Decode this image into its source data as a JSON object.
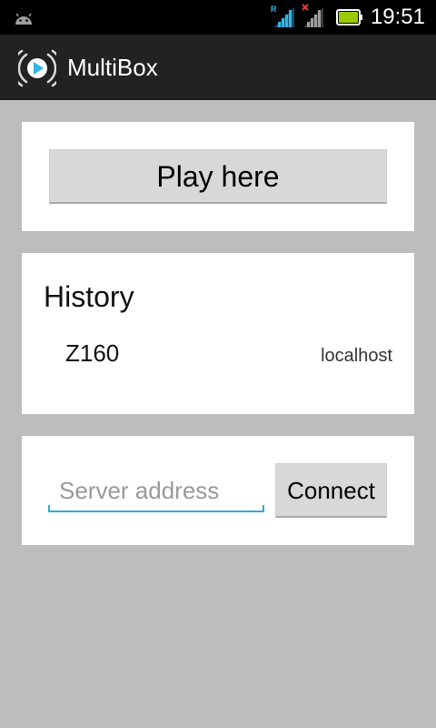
{
  "status_bar": {
    "time": "19:51",
    "roaming_indicator": "R",
    "icons": [
      "android-icon",
      "signal-roaming-icon",
      "signal-no-data-icon",
      "battery-icon"
    ],
    "battery_color": "#99cc00"
  },
  "action_bar": {
    "title": "MultiBox",
    "icon": "multibox-logo-icon",
    "accent": "#33b5e5"
  },
  "play_card": {
    "play_label": "Play here"
  },
  "history": {
    "title": "History",
    "items": [
      {
        "name": "Z160",
        "host": "localhost"
      }
    ]
  },
  "connect_card": {
    "address_value": "",
    "address_placeholder": "Server address",
    "connect_label": "Connect",
    "input_underline_color": "#33a9d6"
  }
}
